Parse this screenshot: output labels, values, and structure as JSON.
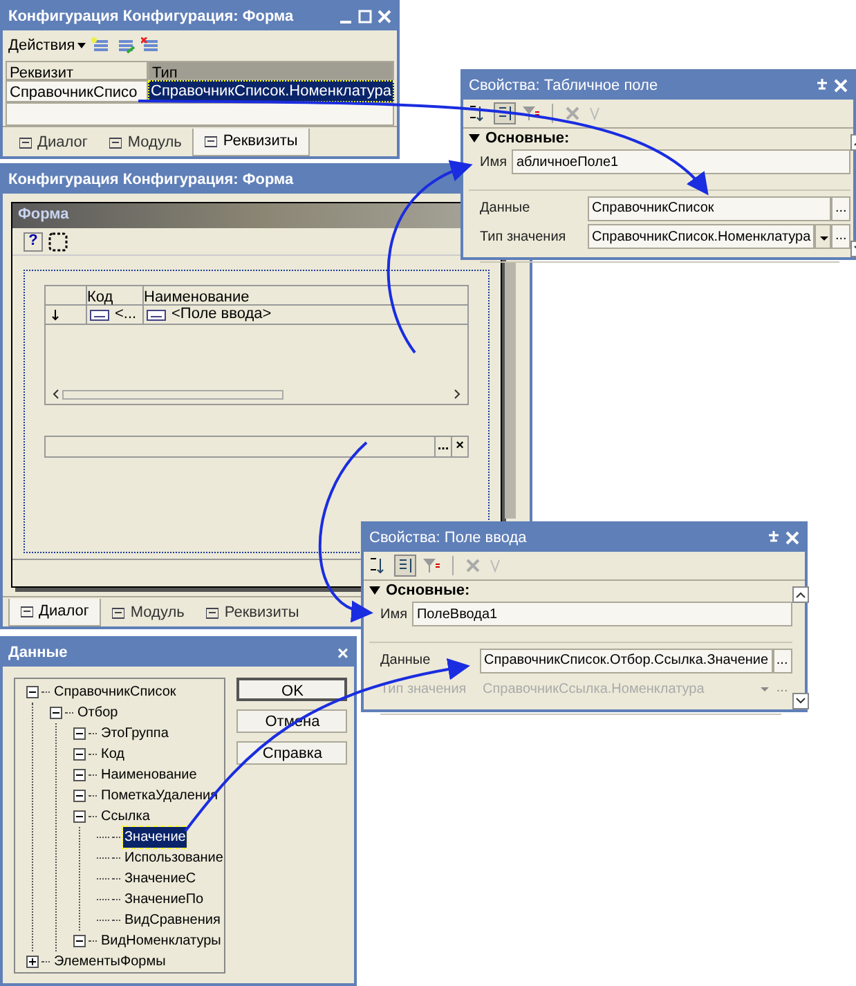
{
  "form_config_window": {
    "title": "Конфигурация Конфигурация: Форма",
    "actions_menu": "Действия",
    "table": {
      "columns": [
        "Реквизит",
        "Тип"
      ],
      "rows": [
        {
          "name": "СправочникСписо",
          "type": "СправочникСписок.Номенклатура",
          "selected": true
        }
      ]
    },
    "tabs": [
      {
        "label": "Диалог",
        "selected": false
      },
      {
        "label": "Модуль",
        "selected": false
      },
      {
        "label": "Реквизиты",
        "selected": true
      }
    ]
  },
  "table_field_properties": {
    "title": "Свойства: Табличное поле",
    "section": "Основные:",
    "properties": [
      {
        "label": "Имя",
        "value": "абличноеПоле1",
        "kind": "text",
        "disabled": false
      },
      {
        "label": "Данные",
        "value": "СправочникСписок",
        "kind": "select",
        "buttons": [
          "..."
        ],
        "disabled": false
      },
      {
        "label": "Тип значения",
        "value": "СправочникСписок.Номенклатура",
        "kind": "dropdown",
        "buttons": [
          "..."
        ],
        "disabled": false
      }
    ]
  },
  "form_window": {
    "title": "Конфигурация Конфигурация: Форма",
    "designer_title": "Форма",
    "help_button": "?",
    "grid": {
      "columns": [
        "Код",
        "Наименование"
      ],
      "row": [
        "<...",
        "<Поле ввода>"
      ]
    },
    "input_buttons": [
      "...",
      "×"
    ],
    "tabs": [
      {
        "label": "Диалог",
        "selected": true
      },
      {
        "label": "Модуль",
        "selected": false
      },
      {
        "label": "Реквизиты",
        "selected": false
      }
    ]
  },
  "input_field_properties": {
    "title": "Свойства: Поле ввода",
    "section": "Основные:",
    "properties": [
      {
        "label": "Имя",
        "value": "ПолеВвода1",
        "kind": "text",
        "disabled": false
      },
      {
        "label": "Данные",
        "value": "СправочникСписок.Отбор.Ссылка.Значение",
        "kind": "select",
        "buttons": [
          "..."
        ],
        "disabled": false
      },
      {
        "label": "Тип значения",
        "value": "СправочникСсылка.Номенклатура",
        "kind": "dropdown",
        "buttons": [
          "..."
        ],
        "disabled": true
      }
    ]
  },
  "data_dialog": {
    "title": "Данные",
    "close": "×",
    "buttons": [
      "OK",
      "Отмена",
      "Справка"
    ],
    "tree": [
      {
        "label": "СправочникСписок",
        "expanded": true,
        "selected": false,
        "children": [
          {
            "label": "Отбор",
            "expanded": true,
            "selected": false,
            "children": [
              {
                "label": "ЭтоГруппа",
                "expanded": true,
                "selected": false
              },
              {
                "label": "Код",
                "expanded": true,
                "selected": false
              },
              {
                "label": "Наименование",
                "expanded": true,
                "selected": false
              },
              {
                "label": "ПометкаУдаления",
                "expanded": true,
                "selected": false
              },
              {
                "label": "Ссылка",
                "expanded": true,
                "selected": false,
                "children": [
                  {
                    "label": "Значение",
                    "selected": true
                  },
                  {
                    "label": "Использование",
                    "selected": false
                  },
                  {
                    "label": "ЗначениеС",
                    "selected": false
                  },
                  {
                    "label": "ЗначениеПо",
                    "selected": false
                  },
                  {
                    "label": "ВидСравнения",
                    "selected": false
                  }
                ]
              },
              {
                "label": "ВидНоменклатуры",
                "expanded": true,
                "selected": false
              }
            ]
          }
        ]
      },
      {
        "label": "ЭлементыФормы",
        "expanded": false,
        "selected": false
      }
    ]
  }
}
